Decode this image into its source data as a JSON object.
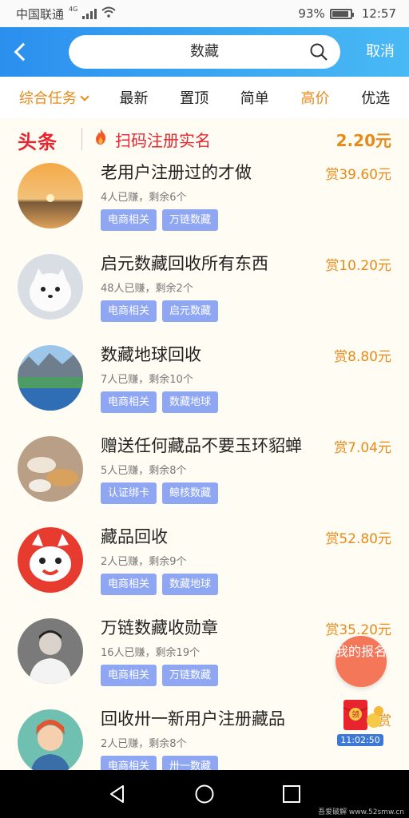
{
  "status_bar": {
    "carrier": "中国联通",
    "network": "4G",
    "battery": "93%",
    "time": "12:57"
  },
  "search": {
    "query": "数藏",
    "cancel_label": "取消"
  },
  "tabs": [
    {
      "label": "综合任务",
      "active": true
    },
    {
      "label": "最新"
    },
    {
      "label": "置顶"
    },
    {
      "label": "简单"
    },
    {
      "label": "高价",
      "highlight": true
    },
    {
      "label": "优选"
    }
  ],
  "banner": {
    "brand": "头条",
    "text": "扫码注册实名",
    "price": "2.20元"
  },
  "tasks": [
    {
      "title": "老用户注册过的才做",
      "reward": "赏39.60元",
      "stats": "4人已赚，剩余6个",
      "tags": [
        "电商相关",
        "万链数藏"
      ]
    },
    {
      "title": "启元数藏回收所有东西",
      "reward": "赏10.20元",
      "stats": "48人已赚，剩余2个",
      "tags": [
        "电商相关",
        "启元数藏"
      ]
    },
    {
      "title": "数藏地球回收",
      "reward": "赏8.80元",
      "stats": "7人已赚，剩余10个",
      "tags": [
        "电商相关",
        "数藏地球"
      ]
    },
    {
      "title": "赠送任何藏品不要玉环貂蝉",
      "reward": "赏7.04元",
      "stats": "5人已赚，剩余8个",
      "tags": [
        "认证绑卡",
        "鲸核数藏"
      ]
    },
    {
      "title": "藏品回收",
      "reward": "赏52.80元",
      "stats": "2人已赚，剩余9个",
      "tags": [
        "电商相关",
        "数藏地球"
      ]
    },
    {
      "title": "万链数藏收勋章",
      "reward": "赏35.20元",
      "stats": "16人已赚，剩余19个",
      "tags": [
        "电商相关",
        "万链数藏"
      ]
    },
    {
      "title": "回收卅一新用户注册藏品",
      "reward": "赏",
      "stats": "2人已赚，剩余8个",
      "tags": [
        "电商相关",
        "卅一数藏"
      ]
    }
  ],
  "float": {
    "signup": "我的报名",
    "redpack_label": "领",
    "timer": "11:02:50"
  },
  "watermark": "吾爱破解 www.52smw.cn",
  "colors": {
    "header_blue": "#2b8fee",
    "accent_orange": "#e88a1a",
    "tag_blue": "#8fa7f3",
    "brand_red": "#e8242e"
  }
}
